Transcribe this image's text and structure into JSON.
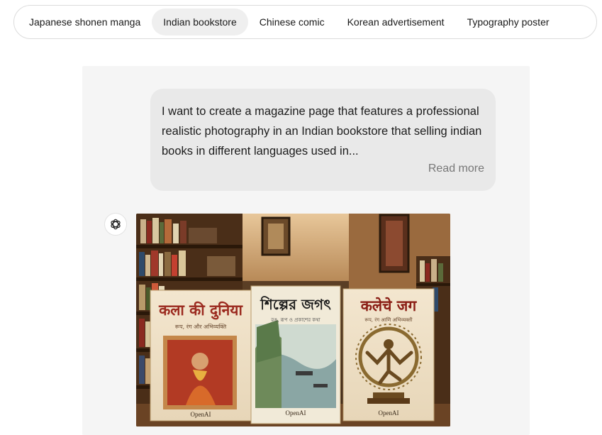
{
  "tabs": [
    {
      "label": "Japanese shonen manga",
      "active": false
    },
    {
      "label": "Indian bookstore",
      "active": true
    },
    {
      "label": "Chinese comic",
      "active": false
    },
    {
      "label": "Korean advertisement",
      "active": false
    },
    {
      "label": "Typography poster",
      "active": false
    }
  ],
  "prompt": {
    "text": "I want to create a magazine page that features a professional realistic photography in an Indian bookstore that selling indian books in different languages used in...",
    "read_more": "Read more"
  },
  "assistant": {
    "icon": "openai-logo-icon"
  },
  "books": [
    {
      "title": "कला की दुनिया",
      "subtitle": "रूप, रंग और अभिव्यक्ति",
      "brand": "OpenAI",
      "color": "#9b2a1f"
    },
    {
      "title": "শিল্পের জগৎ",
      "subtitle": "রঙ, রূপ ও প্রকাশের কথা",
      "brand": "OpenAI",
      "color": "#1a1a1a"
    },
    {
      "title": "कलेचे जग",
      "subtitle": "रूप, रंग आणि अभिव्यक्ती",
      "brand": "OpenAI",
      "color": "#8a1d14"
    }
  ]
}
